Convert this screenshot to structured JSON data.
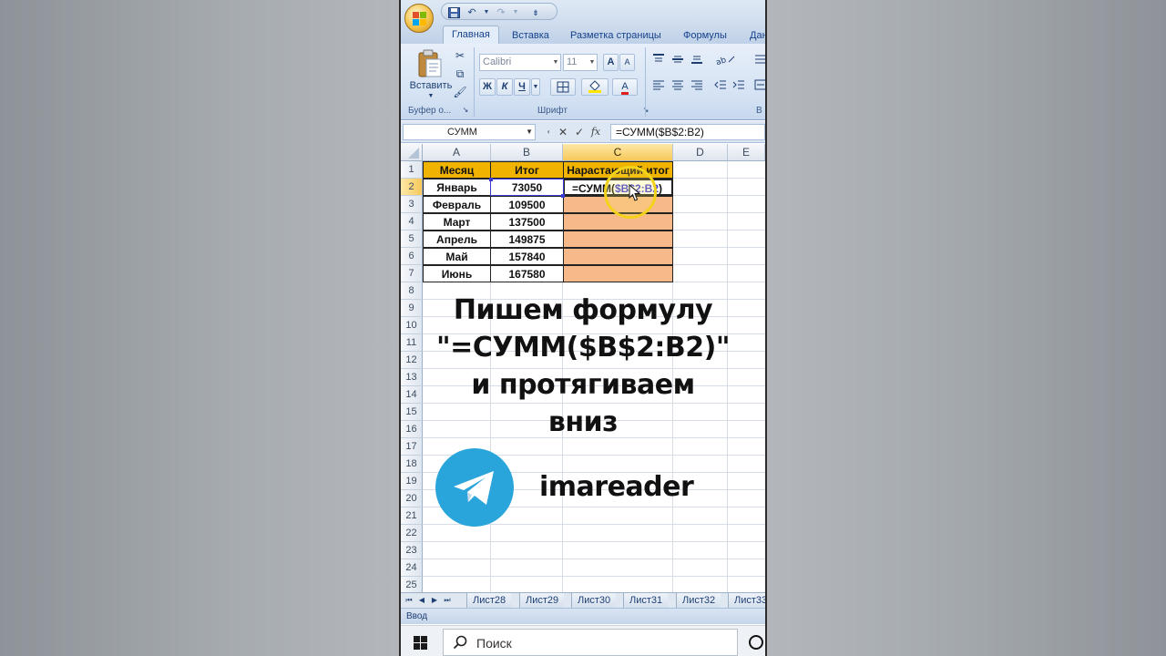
{
  "ribbon": {
    "tabs": [
      "Главная",
      "Вставка",
      "Разметка страницы",
      "Формулы",
      "Дан"
    ],
    "paste_label": "Вставить",
    "clipboard_group": "Буфер о...",
    "font_group": "Шрифт",
    "alignment_group": "В",
    "font_name": "Calibri",
    "font_size": "11",
    "grow_font": "A",
    "shrink_font": "A",
    "bold": "Ж",
    "italic": "К",
    "underline": "Ч",
    "font_color": "A"
  },
  "formula_bar": {
    "name_box": "СУММ",
    "cancel": "✕",
    "enter": "✓",
    "fx": "fx",
    "formula": "=СУММ($B$2:B2)"
  },
  "sheet": {
    "columns": [
      "A",
      "B",
      "C",
      "D",
      "E"
    ],
    "rows": [
      "1",
      "2",
      "3",
      "4",
      "5",
      "6",
      "7",
      "8",
      "9",
      "10",
      "11",
      "12",
      "13",
      "14",
      "15",
      "16",
      "17",
      "18",
      "19",
      "20",
      "21",
      "22",
      "23",
      "24",
      "25"
    ],
    "headers": [
      "Месяц",
      "Итог",
      "Нарастающий итог"
    ],
    "months": [
      "Январь",
      "Февраль",
      "Март",
      "Апрель",
      "Май",
      "Июнь"
    ],
    "totals": [
      "73050",
      "109500",
      "137500",
      "149875",
      "157840",
      "167580"
    ],
    "editing_prefix": "=СУММ(",
    "editing_ref": "$B$2:B2",
    "editing_suffix": ")"
  },
  "overlay": {
    "caption_lines": [
      "Пишем формулу",
      "\"=СУММ($B$2:B2)\"",
      "и протягиваем",
      "вниз"
    ],
    "telegram_handle": "imareader"
  },
  "sheet_tabs": [
    "Лист28",
    "Лист29",
    "Лист30",
    "Лист31",
    "Лист32",
    "Лист33"
  ],
  "status": "Ввод",
  "taskbar": {
    "search_placeholder": "Поиск"
  },
  "colors": {
    "header_fill": "#f0b400",
    "result_fill": "#f8b98a",
    "telegram_blue": "#2aa5dc",
    "ribbon_text": "#15428b"
  }
}
